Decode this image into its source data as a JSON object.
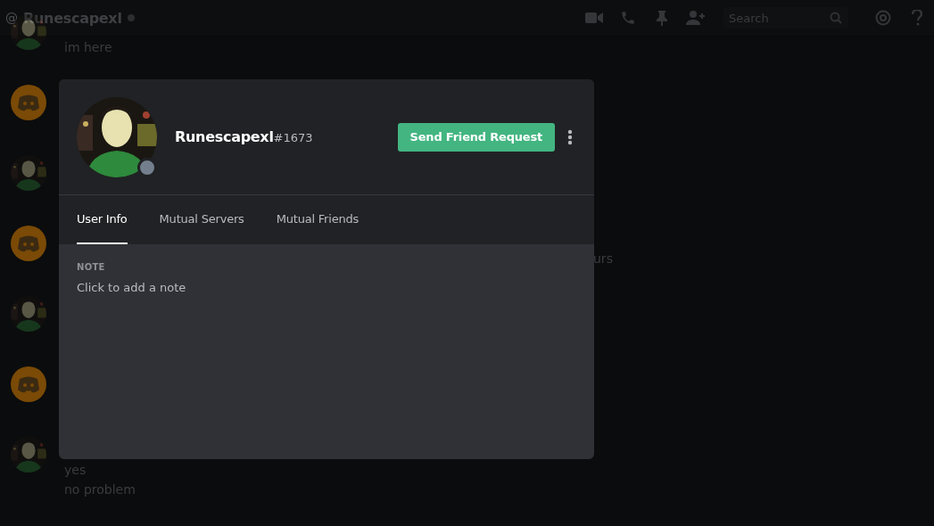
{
  "header": {
    "at_sign": "@",
    "channel_name": "Runescapexl",
    "search": {
      "placeholder": "Search"
    }
  },
  "messages": [
    {
      "kind": "user",
      "lines": [
        "im here"
      ]
    },
    {
      "kind": "bot"
    },
    {
      "kind": "user"
    },
    {
      "kind": "bot",
      "text_behind_dialog": "urs"
    },
    {
      "kind": "user"
    },
    {
      "kind": "bot"
    },
    {
      "kind": "user",
      "lines": [
        "yes",
        "no problem"
      ]
    }
  ],
  "profile": {
    "username": "Runescapexl",
    "discriminator": "#1673",
    "online": false,
    "action_button": "Send Friend Request",
    "tabs": [
      {
        "label": "User Info",
        "selected": true
      },
      {
        "label": "Mutual Servers",
        "selected": false
      },
      {
        "label": "Mutual Friends",
        "selected": false
      }
    ],
    "note": {
      "label": "NOTE",
      "placeholder": "Click to add a note"
    }
  }
}
